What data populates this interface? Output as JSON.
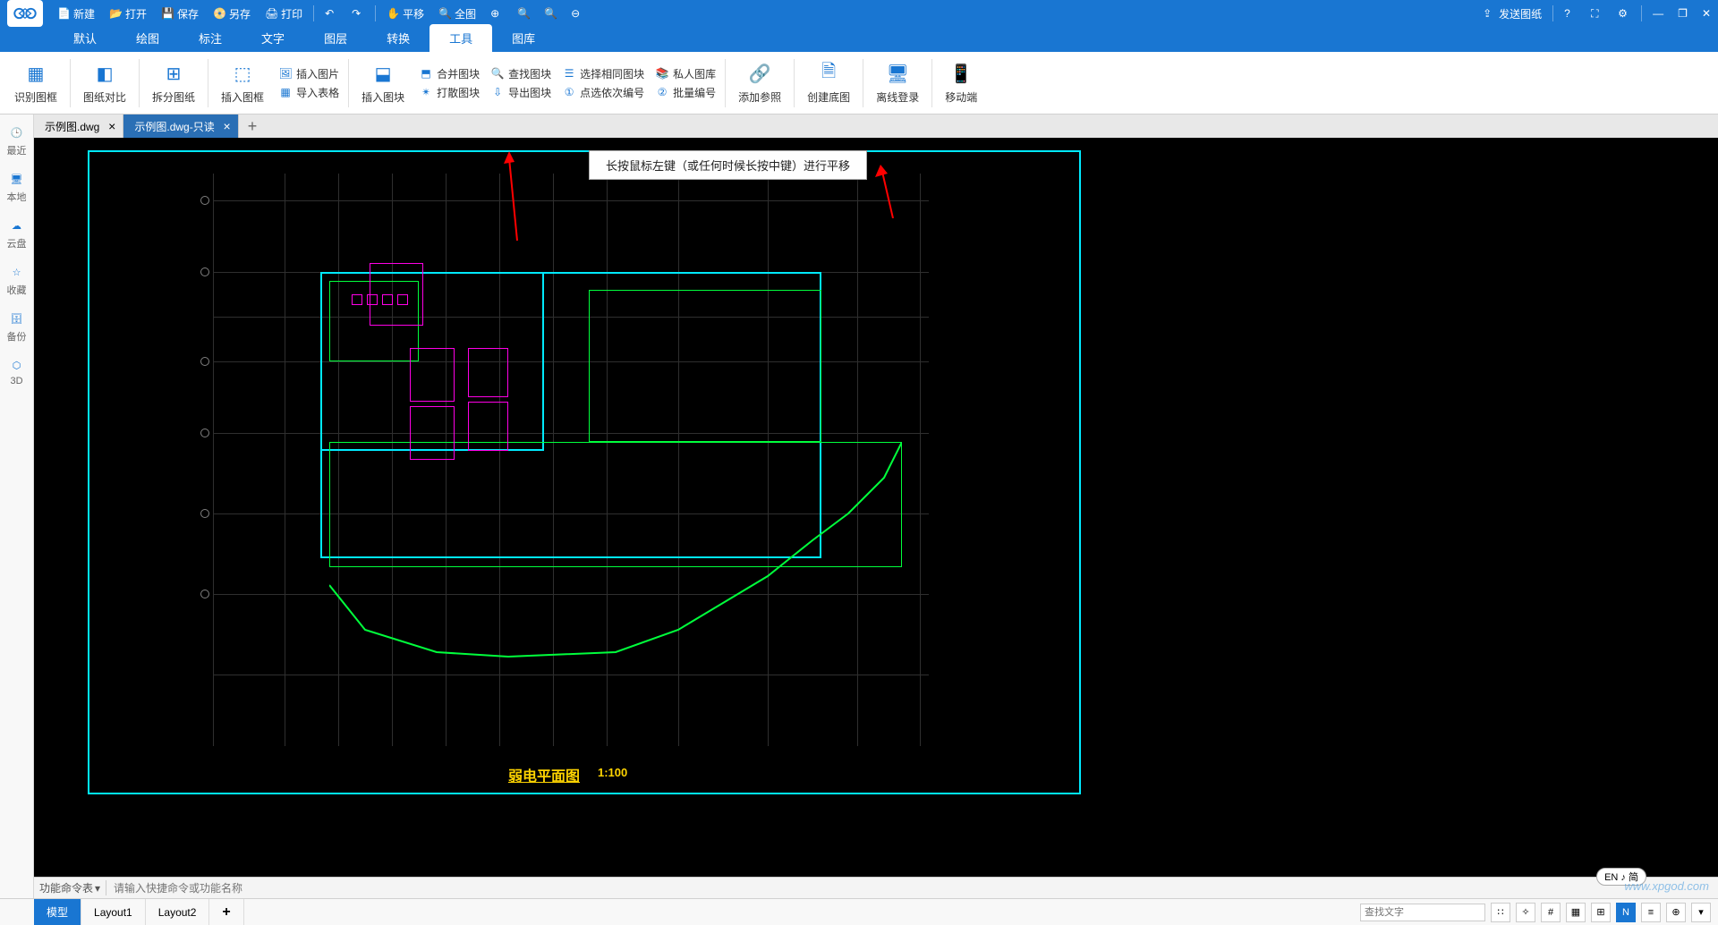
{
  "titlebar": {
    "new": "新建",
    "open": "打开",
    "save": "保存",
    "saveas": "另存",
    "print": "打印",
    "pan": "平移",
    "full": "全图",
    "send": "发送图纸"
  },
  "menubar": {
    "items": [
      "默认",
      "绘图",
      "标注",
      "文字",
      "图层",
      "转换",
      "工具",
      "图库"
    ],
    "active_index": 6
  },
  "ribbon": {
    "big": [
      {
        "label": "识别图框"
      },
      {
        "label": "图纸对比"
      },
      {
        "label": "拆分图纸"
      },
      {
        "label": "插入图框"
      },
      {
        "label": "插入图块"
      },
      {
        "label": "添加参照"
      },
      {
        "label": "创建底图"
      },
      {
        "label": "离线登录"
      },
      {
        "label": "移动端"
      }
    ],
    "col1": [
      {
        "label": "插入图片"
      },
      {
        "label": "导入表格"
      }
    ],
    "col2": [
      {
        "label": "合并图块"
      },
      {
        "label": "打散图块"
      }
    ],
    "col3": [
      {
        "label": "查找图块"
      },
      {
        "label": "导出图块"
      }
    ],
    "col4": [
      {
        "label": "选择相同图块"
      },
      {
        "label": "点选依次编号"
      }
    ],
    "col5": [
      {
        "label": "私人图库"
      },
      {
        "label": "批量编号"
      }
    ]
  },
  "sidebar": {
    "items": [
      {
        "label": "最近"
      },
      {
        "label": "本地"
      },
      {
        "label": "云盘"
      },
      {
        "label": "收藏"
      },
      {
        "label": "备份"
      },
      {
        "label": "3D"
      }
    ]
  },
  "tabs": {
    "items": [
      {
        "label": "示例图.dwg",
        "active": false
      },
      {
        "label": "示例图.dwg-只读",
        "active": true
      }
    ]
  },
  "tooltip": "长按鼠标左键（或任何时候长按中键）进行平移",
  "drawing": {
    "title": "弱电平面图",
    "scale": "1:100"
  },
  "cmdbar": {
    "label": "功能命令表",
    "placeholder": "请输入快捷命令或功能名称"
  },
  "statusbar": {
    "tabs": [
      "模型",
      "Layout1",
      "Layout2"
    ],
    "active_index": 0,
    "search_placeholder": "查找文字"
  },
  "lang_badge": "EN ♪ 简",
  "watermark": "www.xpgod.com"
}
